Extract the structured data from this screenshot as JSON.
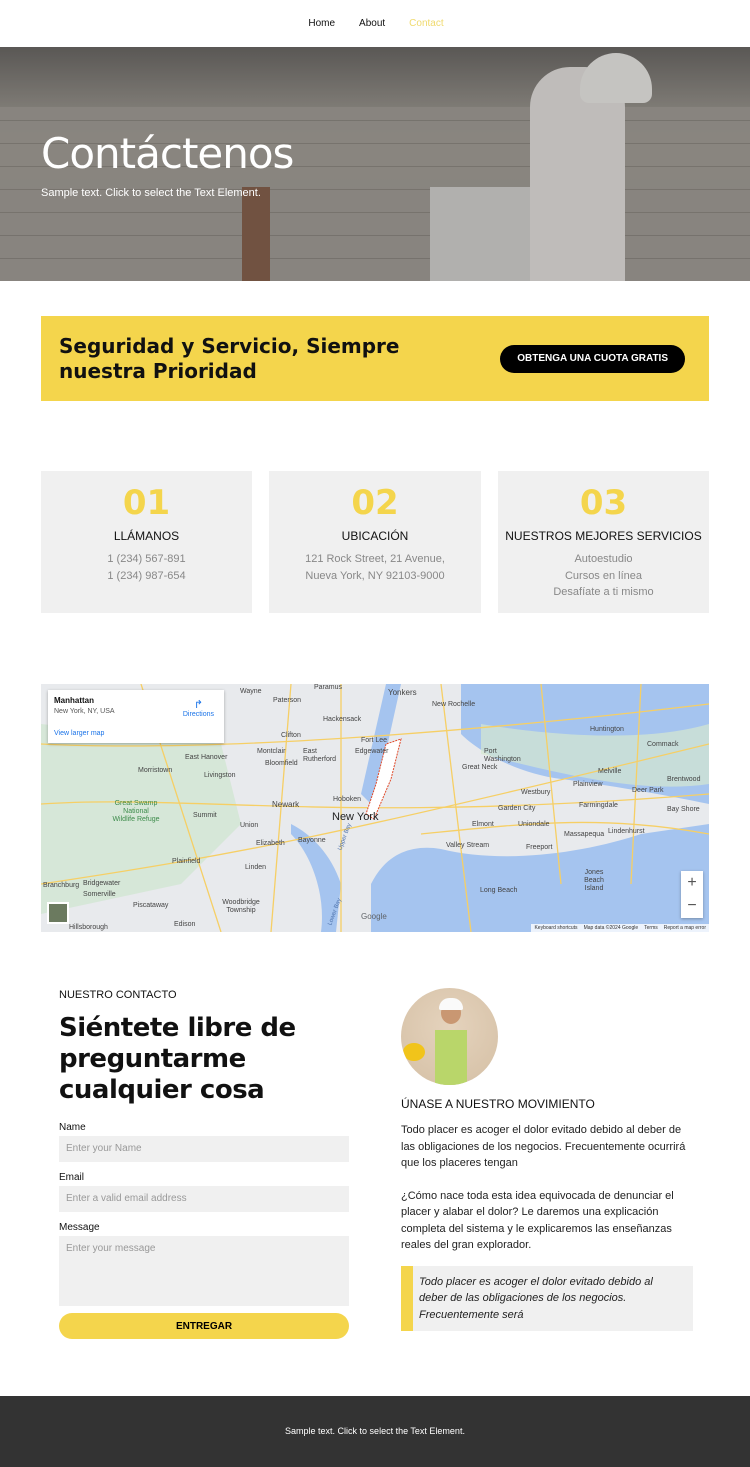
{
  "nav": {
    "items": [
      {
        "label": "Home",
        "active": false
      },
      {
        "label": "About",
        "active": false
      },
      {
        "label": "Contact",
        "active": true
      }
    ],
    "active_color": "#f0da6e"
  },
  "hero": {
    "title": "Contáctenos",
    "subtitle": "Sample text. Click to select the Text Element."
  },
  "banner": {
    "title": "Seguridad y Servicio, Siempre nuestra Prioridad",
    "button": "OBTENGA UNA CUOTA GRATIS",
    "color": "#f4d54c"
  },
  "cards": [
    {
      "number": "01",
      "title": "LLÁMANOS",
      "lines": [
        "1 (234) 567-891",
        "1 (234) 987-654"
      ]
    },
    {
      "number": "02",
      "title": "UBICACIÓN",
      "lines": [
        "121 Rock Street, 21 Avenue,",
        "Nueva York, NY 92103-9000"
      ]
    },
    {
      "number": "03",
      "title": "NUESTROS MEJORES SERVICIOS",
      "lines": [
        "Autoestudio",
        "Cursos en línea",
        "Desafíate a ti mismo"
      ]
    }
  ],
  "map": {
    "place": "Manhattan",
    "address": "New York, NY, USA",
    "directions": "Directions",
    "larger": "View larger map",
    "zoom_in": "+",
    "zoom_out": "−",
    "google": "Google",
    "attribution": [
      "Keyboard shortcuts",
      "Map data ©2024 Google",
      "Terms",
      "Report a map error"
    ],
    "labels": [
      "Paramus",
      "Yonkers",
      "Wayne",
      "Paterson",
      "New Rochelle",
      "Hackensack",
      "Clifton",
      "Fort Lee",
      "East Rutherford",
      "Montclair",
      "Edgewater",
      "East Hanover",
      "Bloomfield",
      "Port Washington",
      "Great Neck",
      "Huntington",
      "Commack",
      "Morristown",
      "Livingston",
      "Melville",
      "Plainview",
      "Brentwood",
      "Deer Park",
      "Great Swamp National Wildlife Refuge",
      "Newark",
      "Hoboken",
      "Westbury",
      "Farmingdale",
      "Bay Shore",
      "Summit",
      "New York",
      "Garden City",
      "Union",
      "Elmont",
      "Uniondale",
      "Massapequa",
      "Lindenhurst",
      "Elizabeth",
      "Bayonne",
      "Valley Stream",
      "Freeport",
      "Plainfield",
      "Linden",
      "Jones Beach Island",
      "Branchburg",
      "Bridgewater",
      "Somerville",
      "Long Beach",
      "Piscataway",
      "Woodbridge Township",
      "Hillsborough",
      "Edison",
      "Upper Bay",
      "Lower Bay"
    ]
  },
  "contact": {
    "kicker": "NUESTRO CONTACTO",
    "title": "Siéntete libre de preguntarme cualquier cosa",
    "fields": [
      {
        "label": "Name",
        "placeholder": "Enter your Name"
      },
      {
        "label": "Email",
        "placeholder": "Enter a valid email address"
      },
      {
        "label": "Message",
        "placeholder": "Enter your message"
      }
    ],
    "submit": "ENTREGAR"
  },
  "movement": {
    "title": "ÚNASE A NUESTRO MOVIMIENTO",
    "p1": "Todo placer es acoger el dolor evitado debido al deber de las obligaciones de los negocios. Frecuentemente ocurrirá que los placeres tengan",
    "p2": "¿Cómo nace toda esta idea equivocada de denunciar el placer y alabar el dolor? Le daremos una explicación completa del sistema y le explicaremos las enseñanzas reales del gran explorador.",
    "quote": "Todo placer es acoger el dolor evitado debido al deber de las obligaciones de los negocios. Frecuentemente será"
  },
  "footer": {
    "text": "Sample text. Click to select the Text Element."
  }
}
